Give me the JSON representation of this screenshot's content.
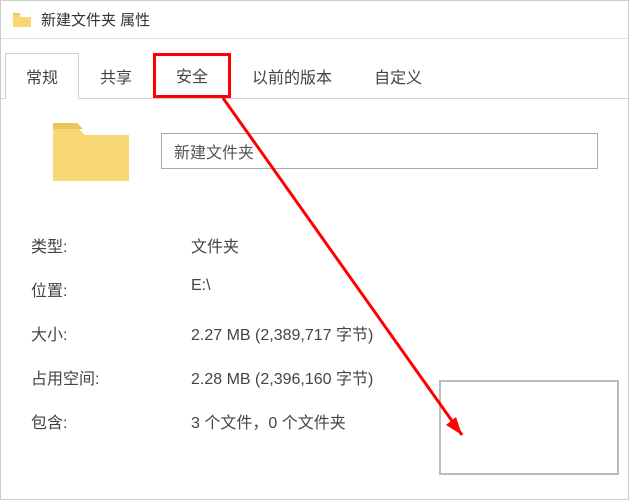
{
  "titlebar": {
    "title": "新建文件夹 属性"
  },
  "tabs": [
    {
      "label": "常规",
      "active": true
    },
    {
      "label": "共享",
      "active": false
    },
    {
      "label": "安全",
      "active": false,
      "highlighted": true
    },
    {
      "label": "以前的版本",
      "active": false
    },
    {
      "label": "自定义",
      "active": false
    }
  ],
  "folder_name": "新建文件夹",
  "properties": {
    "type_label": "类型:",
    "type_value": "文件夹",
    "location_label": "位置:",
    "location_value": "E:\\",
    "size_label": "大小:",
    "size_value": "2.27 MB (2,389,717 字节)",
    "disk_size_label": "占用空间:",
    "disk_size_value": "2.28 MB (2,396,160 字节)",
    "contains_label": "包含:",
    "contains_value": "3 个文件，0 个文件夹"
  },
  "icons": {
    "folder_color": "#f8d775",
    "folder_tab_color": "#e8c45a"
  }
}
